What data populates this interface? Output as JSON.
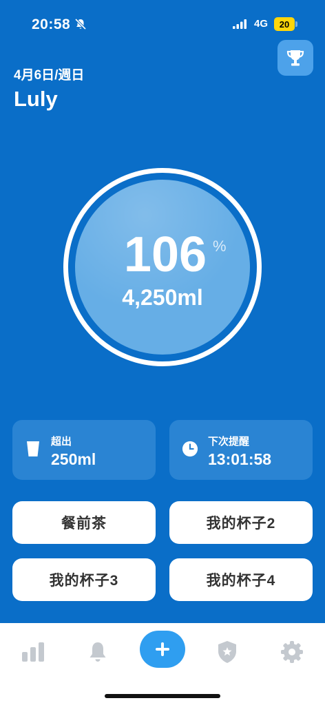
{
  "status_bar": {
    "time": "20:58",
    "network": "4G",
    "battery": "20",
    "icons": [
      "bell-slash-icon",
      "signal-icon",
      "battery-icon"
    ]
  },
  "header": {
    "date": "4月6日/週日",
    "user_name": "Luly",
    "trophy_icon": "trophy-icon"
  },
  "progress": {
    "percent": "106",
    "percent_sign": "%",
    "amount": "4,250ml"
  },
  "cards": {
    "excess": {
      "label": "超出",
      "value": "250ml",
      "icon": "cup-icon"
    },
    "next_reminder": {
      "label": "下次提醒",
      "value": "13:01:58",
      "icon": "clock-icon"
    }
  },
  "cups": [
    {
      "label": "餐前茶"
    },
    {
      "label": "我的杯子2"
    },
    {
      "label": "我的杯子3"
    },
    {
      "label": "我的杯子4"
    }
  ],
  "tab_bar": {
    "items": [
      "stats-icon",
      "bell-icon",
      "add-icon",
      "shield-icon",
      "settings-icon"
    ],
    "active": "add-icon"
  },
  "colors": {
    "background": "#0a6ec8",
    "circle_fill": "#66aee6",
    "card_bg": "#2a84d3",
    "accent": "#2f9ef0",
    "battery": "#ffd60a",
    "tab_icon": "#c4c9cf"
  }
}
